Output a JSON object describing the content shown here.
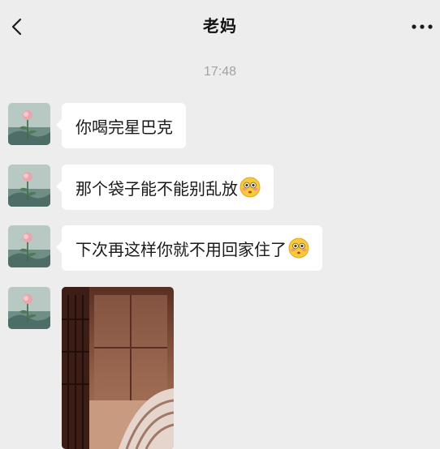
{
  "header": {
    "title": "老妈",
    "back_icon": "chevron-left-icon",
    "more_icon": "more-dots-icon"
  },
  "chat": {
    "timestamp": "17:48",
    "messages": [
      {
        "sender": "老妈",
        "text": "你喝完星巴克",
        "emoji": ""
      },
      {
        "sender": "老妈",
        "text": "那个袋子能不能别乱放",
        "emoji": "flushed-face-emoji"
      },
      {
        "sender": "老妈",
        "text": "下次再这样你就不用回家住了",
        "emoji": "flushed-face-emoji"
      },
      {
        "sender": "老妈",
        "type": "image",
        "emoji": ""
      }
    ]
  },
  "colors": {
    "background": "#ededed",
    "bubble": "#ffffff",
    "text": "#1a1a1a",
    "timestamp": "#a3a3a3"
  }
}
